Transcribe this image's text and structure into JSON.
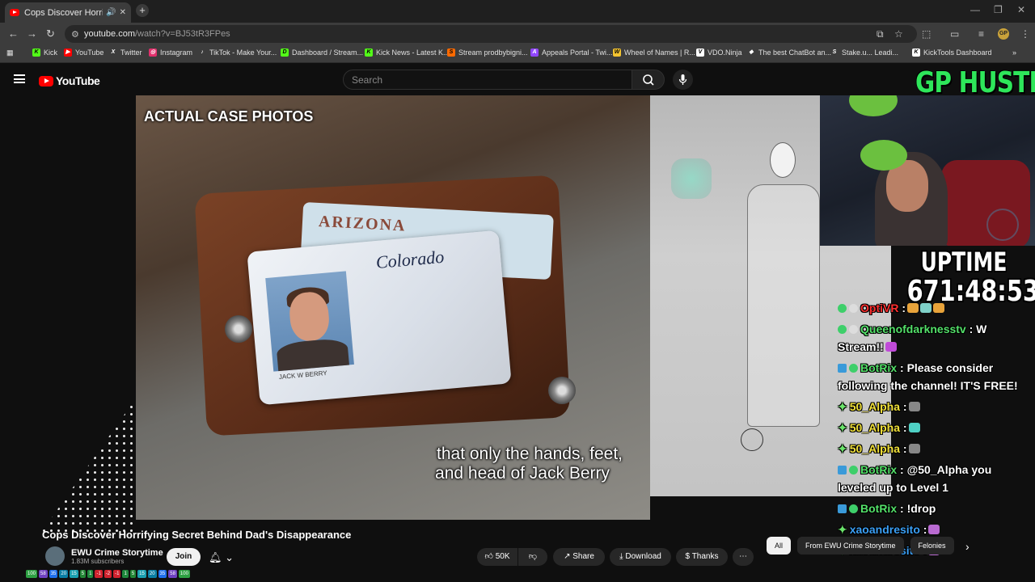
{
  "browser": {
    "tab_title": "Cops Discover Horrifying Se",
    "url_host": "youtube.com",
    "url_path": "/watch?v=BJ53tR3FPes",
    "bookmarks": [
      {
        "label": "Kick",
        "color": "#53fc18",
        "icon_text": "K"
      },
      {
        "label": "YouTube",
        "color": "#ff0000",
        "icon_text": "▶"
      },
      {
        "label": "Twitter",
        "color": "#ffffff",
        "icon_text": "X"
      },
      {
        "label": "Instagram",
        "color": "#e1306c",
        "icon_text": "◎"
      },
      {
        "label": "TikTok - Make Your...",
        "color": "#ffffff",
        "icon_text": "♪"
      },
      {
        "label": "Dashboard / Stream...",
        "color": "#53fc18",
        "icon_text": "D"
      },
      {
        "label": "Kick News - Latest K...",
        "color": "#53fc18",
        "icon_text": "K"
      },
      {
        "label": "Stream prodbybigni...",
        "color": "#ff6a00",
        "icon_text": "S"
      },
      {
        "label": "Appeals Portal - Twi...",
        "color": "#9146ff",
        "icon_text": "A"
      },
      {
        "label": "Wheel of Names | R...",
        "color": "#f4c430",
        "icon_text": "W"
      },
      {
        "label": "VDO.Ninja",
        "color": "#ffffff",
        "icon_text": "V"
      },
      {
        "label": "The best ChatBot an...",
        "color": "#ffffff",
        "icon_text": "◆"
      },
      {
        "label": "Stake.u... Leadi...",
        "color": "#ffffff",
        "icon_text": "S"
      },
      {
        "label": "KickTools Dashboard",
        "color": "#ffffff",
        "icon_text": "K"
      }
    ]
  },
  "youtube": {
    "logo_text": "YouTube",
    "search_placeholder": "Search"
  },
  "video": {
    "corner_label": "ACTUAL CASE PHOTOS",
    "subtitle_line1": "that only the hands, feet,",
    "subtitle_line2": "and head of Jack Berry",
    "card_state": "Colorado",
    "card_back_text": "ARIZONA",
    "card_name": "JACK W BERRY"
  },
  "overlay": {
    "brand": "GP HUSTLA",
    "uptime_label": "UPTIME",
    "uptime_value": "671:48:53",
    "chat": [
      {
        "user": "OptiVR",
        "user_color": "red",
        "text": ":",
        "emotes": [
          "#e8a33a",
          "#7fd1c8",
          "#e8a33a"
        ]
      },
      {
        "user": "Queenofdarknesstv",
        "user_color": "green",
        "text": ": W Stream!!",
        "emotes": [
          "#c04bd8"
        ]
      },
      {
        "user": "BotRix",
        "user_color": "green",
        "text": ": Please consider following the channel! IT'S FREE!",
        "emotes": []
      },
      {
        "user": "50_Alpha",
        "user_color": "yellow",
        "text": ":",
        "emotes": [
          "#888888"
        ]
      },
      {
        "user": "50_Alpha",
        "user_color": "yellow",
        "text": ":",
        "emotes": [
          "#4fd1c5"
        ]
      },
      {
        "user": "50_Alpha",
        "user_color": "yellow",
        "text": ":",
        "emotes": [
          "#888888"
        ]
      },
      {
        "user": "BotRix",
        "user_color": "green",
        "text": ": @50_Alpha you leveled up to Level 1",
        "emotes": []
      },
      {
        "user": "BotRix",
        "user_color": "green",
        "text": ": !drop",
        "emotes": []
      },
      {
        "user": "xaoandresito",
        "user_color": "blue",
        "text": ":",
        "emotes": [
          "#b96ad1"
        ]
      },
      {
        "user": "xaoandresito",
        "user_color": "blue",
        "text": ":",
        "emotes": [
          "#b96ad1"
        ]
      }
    ]
  },
  "info": {
    "title": "Cops Discover Horrifying Secret Behind Dad's Disappearance",
    "channel_name": "EWU Crime Storytime",
    "subscribers": "1.83M subscribers",
    "join_label": "Join",
    "like_count": "50K",
    "share_label": "Share",
    "download_label": "Download",
    "thanks_label": "Thanks",
    "chips": [
      "All",
      "From EWU Crime Storytime",
      "Felonies"
    ]
  },
  "levels": [
    {
      "text": "100",
      "color": "#2ea043"
    },
    {
      "text": "58",
      "color": "#6f42c1"
    },
    {
      "text": "35",
      "color": "#1f6feb"
    },
    {
      "text": "20",
      "color": "#0a7ea4"
    },
    {
      "text": "15",
      "color": "#1a9fb0"
    },
    {
      "text": "5",
      "color": "#238636"
    },
    {
      "text": "1",
      "color": "#1f883d"
    },
    {
      "text": "-1",
      "color": "#cf222e"
    },
    {
      "text": "-2",
      "color": "#cf222e"
    },
    {
      "text": "-1",
      "color": "#cf222e"
    },
    {
      "text": "1",
      "color": "#1f883d"
    },
    {
      "text": "5",
      "color": "#238636"
    },
    {
      "text": "15",
      "color": "#1a9fb0"
    },
    {
      "text": "20",
      "color": "#0a7ea4"
    },
    {
      "text": "35",
      "color": "#1f6feb"
    },
    {
      "text": "58",
      "color": "#6f42c1"
    },
    {
      "text": "100",
      "color": "#2ea043"
    }
  ]
}
